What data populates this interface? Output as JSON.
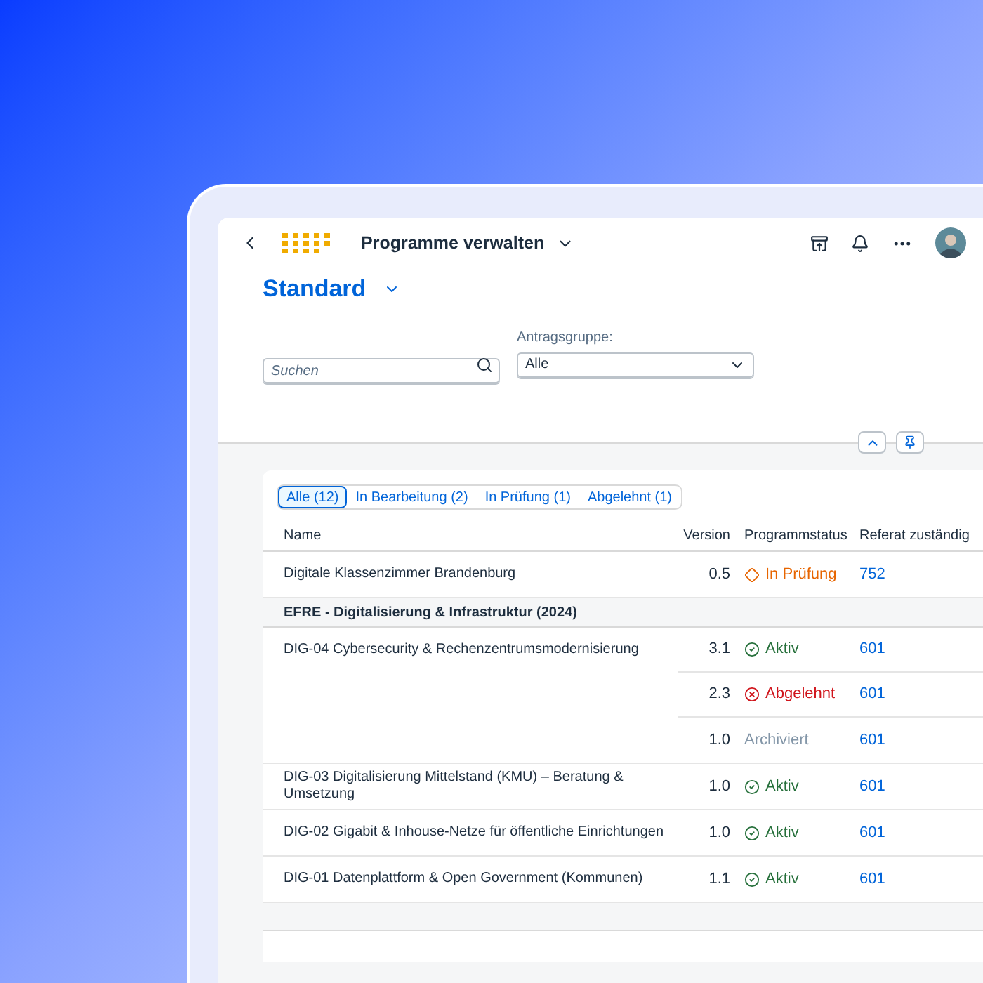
{
  "header": {
    "title": "Programme verwalten"
  },
  "variant": {
    "title": "Standard"
  },
  "filters": {
    "search": {
      "placeholder": "Suchen"
    },
    "group": {
      "label": "Antragsgruppe:",
      "value": "Alle"
    }
  },
  "segments": [
    {
      "label": "Alle (12)",
      "selected": true
    },
    {
      "label": "In Bearbeitung (2)",
      "selected": false
    },
    {
      "label": "In Prüfung (1)",
      "selected": false
    },
    {
      "label": "Abgelehnt (1)",
      "selected": false
    }
  ],
  "table": {
    "columns": [
      "Name",
      "Version",
      "Programmstatus",
      "Referat zuständig"
    ],
    "rows": [
      {
        "kind": "item",
        "name": "Digitale Klassenzimmer Brandenburg",
        "versions": [
          {
            "version": "0.5",
            "status": {
              "kind": "critical",
              "label": "In Prüfung"
            },
            "referat": "752"
          }
        ]
      },
      {
        "kind": "group",
        "label": "EFRE - Digitalisierung & Infrastruktur (2024)"
      },
      {
        "kind": "item",
        "name": "DIG-04 Cybersecurity & Rechenzentrumsmodernisierung",
        "versions": [
          {
            "version": "3.1",
            "status": {
              "kind": "positive",
              "label": "Aktiv"
            },
            "referat": "601"
          },
          {
            "version": "2.3",
            "status": {
              "kind": "negative",
              "label": "Abgelehnt"
            },
            "referat": "601"
          },
          {
            "version": "1.0",
            "status": {
              "kind": "none",
              "label": "Archiviert"
            },
            "referat": "601"
          }
        ]
      },
      {
        "kind": "item",
        "name": "DIG-03 Digitalisierung Mittelstand (KMU) – Beratung & Umsetzung",
        "versions": [
          {
            "version": "1.0",
            "status": {
              "kind": "positive",
              "label": "Aktiv"
            },
            "referat": "601"
          }
        ]
      },
      {
        "kind": "item",
        "name": "DIG-02 Gigabit & Inhouse-Netze für öffentliche Einrichtungen",
        "versions": [
          {
            "version": "1.0",
            "status": {
              "kind": "positive",
              "label": "Aktiv"
            },
            "referat": "601"
          }
        ]
      },
      {
        "kind": "item",
        "name": "DIG-01 Datenplattform & Open Government (Kommunen)",
        "versions": [
          {
            "version": "1.1",
            "status": {
              "kind": "positive",
              "label": "Aktiv"
            },
            "referat": "601"
          }
        ]
      }
    ]
  }
}
